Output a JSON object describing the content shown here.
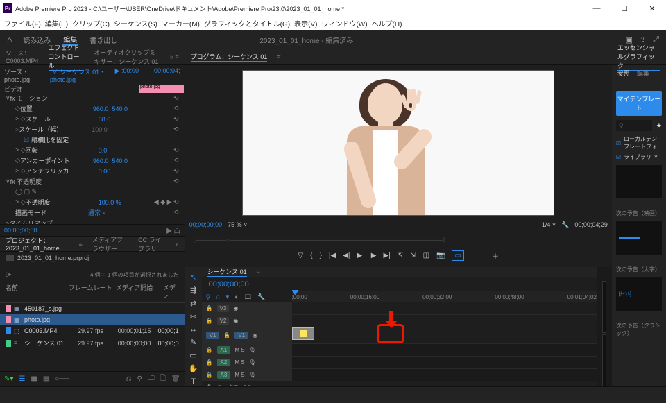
{
  "titlebar": {
    "app": "Adobe Premiere Pro 2023",
    "path": "C:\\ユーザー\\USER\\OneDrive\\ドキュメント\\Adobe\\Premiere Pro\\23.0\\2023_01_01_home *"
  },
  "menubar": {
    "file": "ファイル(F)",
    "edit": "編集(E)",
    "clip": "クリップ(C)",
    "seq": "シーケンス(S)",
    "marker": "マーカー(M)",
    "graphic": "グラフィックとタイトル(G)",
    "view": "表示(V)",
    "window": "ウィンドウ(W)",
    "help": "ヘルプ(H)"
  },
  "worktabs": {
    "import": "読み込み",
    "edit": "編集",
    "export": "書き出し",
    "center": "2023_01_01_home - 編集済み"
  },
  "topPanels": {
    "source": "ソース：C0003.MP4",
    "effect": "エフェクトコントロール",
    "mixer": "オーディオクリップミキサー：シーケンス 01",
    "program": "プログラム：シーケンス 01"
  },
  "ec": {
    "src": "ソース・photo.jpg",
    "seq": "シーケンス 01・photo.jpg",
    "clipName": "photo.jpg",
    "tc_in": ":00:00",
    "tc_out": "00:00:04;",
    "timeOutLabel": "00;00;04;29",
    "durFrac": "1/4",
    "video": "ビデオ",
    "motion": "fx モーション",
    "pos": "位置",
    "posX": "960.0",
    "posY": "540.0",
    "scale": "スケール",
    "scaleV": "58.0",
    "scaleW": "スケール（幅）",
    "scaleWV": "100.0",
    "aspect": "縦横比を固定",
    "rot": "回転",
    "rotV": "0.0",
    "anchor": "アンカーポイント",
    "anchorX": "960.0",
    "anchorY": "540.0",
    "flick": "アンチフリッカー",
    "flickV": "0.00",
    "opacity": "fx 不透明度",
    "opV": "不透明度",
    "opVV": "100.0 %",
    "blend": "描画モード",
    "blendV": "通常",
    "timeremap": "タイムリマップ"
  },
  "prog": {
    "tc": "00;00;00;00",
    "zoom": "75 %"
  },
  "project": {
    "tab": "プロジェクト：2023_01_01_home",
    "mediabrowser": "メディアブラウザー",
    "cclib": "CC ライブラリ",
    "bin": "2023_01_01_home.prproj",
    "status": "4 個中 1 個の項目が選択されました",
    "cols": {
      "name": "名前",
      "fr": "フレームレート",
      "start": "メディア開始",
      "med": "メディ"
    },
    "rows": [
      {
        "chip": "pink",
        "icon": "▦",
        "name": "450187_s.jpg",
        "fr": "",
        "start": ""
      },
      {
        "chip": "pink",
        "icon": "▦",
        "name": "photo.jpg",
        "fr": "",
        "start": "",
        "sel": true
      },
      {
        "chip": "blu",
        "icon": "⬚",
        "name": "C0003.MP4",
        "fr": "29.97 fps",
        "start": "00;00;01;15",
        "med": "00;00;1"
      },
      {
        "chip": "grn",
        "icon": "≡",
        "name": "シーケンス 01",
        "fr": "29.97 fps",
        "start": "00;00;00;00",
        "med": "00;00;0"
      }
    ]
  },
  "timeline": {
    "tab": "シーケンス 01",
    "tc": "00;00;00;00",
    "ticks": [
      ";00;00",
      "00;00;16;00",
      "00;00;32;00",
      "00;00;48;00",
      "00;01;04;02"
    ],
    "tracks": {
      "v3": "V3",
      "v2": "V2",
      "v1": "V1",
      "v1head": "V1",
      "a1": "A1",
      "a2": "A2",
      "a3": "A3",
      "mix": "ミックス",
      "ms": "M S",
      "eye": "◉",
      "lock": "🔒",
      "mic": "🎙",
      "zero": "0.0"
    }
  },
  "right": {
    "panel": "エッセンシャルグラフィック",
    "t1": "参照",
    "t2": "編集",
    "btn": "マイテンプレート",
    "searchPh": "",
    "chk1": "ローカルテンプレートフォ",
    "chk2": "ライブラリ",
    "cap1": "次の予告（映画）",
    "cap2": "次の予告（太字）",
    "cap3": "次の予告（クラシック）",
    "thumbTxt3": "[ﾀｲﾄﾙ]"
  }
}
